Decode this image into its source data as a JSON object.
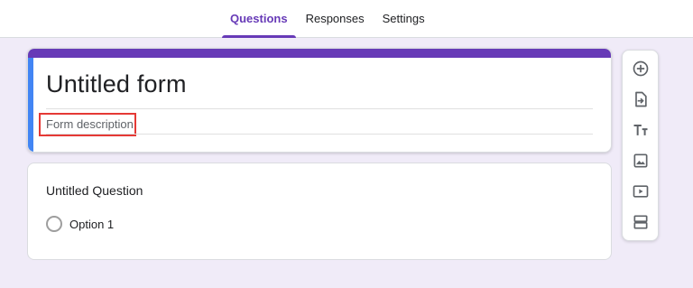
{
  "tabs": [
    {
      "label": "Questions",
      "active": true
    },
    {
      "label": "Responses",
      "active": false
    },
    {
      "label": "Settings",
      "active": false
    }
  ],
  "form": {
    "title": "Untitled form",
    "description_placeholder": "Form description"
  },
  "question": {
    "title": "Untitled Question",
    "options": [
      "Option 1"
    ]
  },
  "toolbar": {
    "tools": [
      "add-question-icon",
      "import-questions-icon",
      "add-title-text-icon",
      "add-image-icon",
      "add-video-icon",
      "add-section-icon"
    ]
  },
  "colors": {
    "accent": "#673ab7",
    "active_card": "#4285f4",
    "background": "#f0ebf8",
    "highlight_box": "#e53935"
  }
}
